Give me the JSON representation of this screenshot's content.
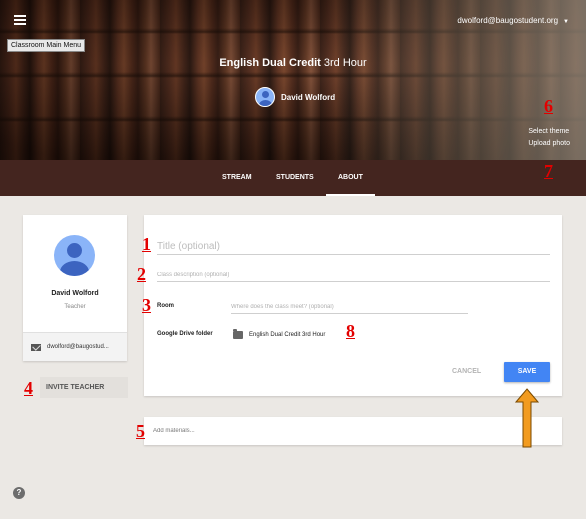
{
  "header": {
    "menu_tooltip": "Classroom Main Menu",
    "account": "dwolford@baugostudent.org",
    "class_name_bold": "English Dual Credit",
    "class_section": "3rd Hour",
    "teacher_name": "David Wolford",
    "select_theme": "Select theme",
    "upload_photo": "Upload photo"
  },
  "tabs": [
    {
      "label": "STREAM"
    },
    {
      "label": "STUDENTS"
    },
    {
      "label": "ABOUT"
    }
  ],
  "active_tab": "ABOUT",
  "profile": {
    "name": "David Wolford",
    "role": "Teacher",
    "email": "dwolford@baugostud..."
  },
  "invite_label": "INVITE TEACHER",
  "form": {
    "title_placeholder": "Title (optional)",
    "description_placeholder": "Class description (optional)",
    "room_label": "Room",
    "room_placeholder": "Where does the class meet? (optional)",
    "drive_label": "Google Drive folder",
    "drive_folder": "English Dual Credit 3rd Hour",
    "cancel_label": "CANCEL",
    "save_label": "SAVE"
  },
  "materials_placeholder": "Add materials...",
  "help_label": "?",
  "annotations": {
    "m1": "1",
    "m2": "2",
    "m3": "3",
    "m4": "4",
    "m5": "5",
    "m6": "6",
    "m7": "7",
    "m8": "8"
  },
  "colors": {
    "tab_bar": "#44251f",
    "save_button": "#4285f4",
    "annotation_red": "#e30000",
    "arrow_orange": "#f29b1f"
  }
}
